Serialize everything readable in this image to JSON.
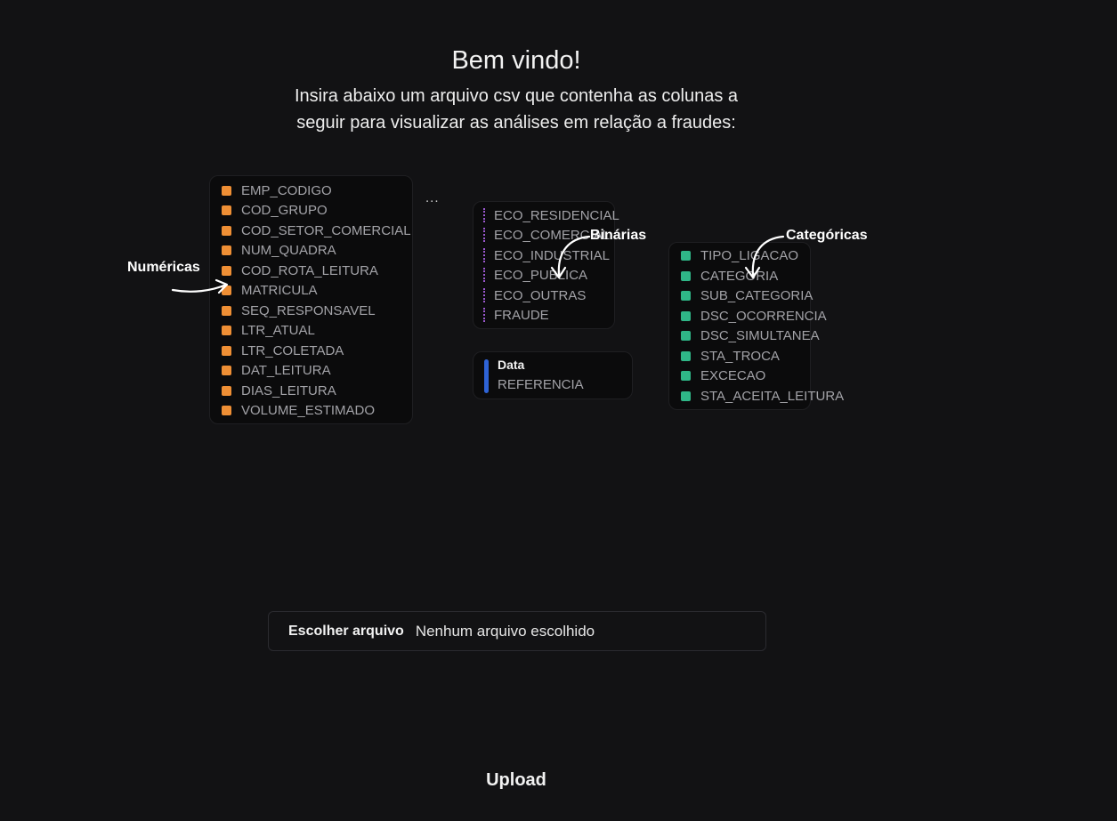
{
  "header": {
    "title": "Bem vindo!",
    "subtitle_line1": "Insira abaixo um arquivo csv que contenha as colunas a",
    "subtitle_line2": "seguir para visualizar as análises em relação a fraudes:"
  },
  "colors": {
    "numeric": "#ef8f35",
    "binary": "#9b59d0",
    "date": "#2e63d6",
    "categorical": "#2fb687",
    "background": "#121214"
  },
  "numeric_columns": {
    "annotation": "Numéricas",
    "items": [
      "EMP_CODIGO",
      "COD_GRUPO",
      "COD_SETOR_COMERCIAL",
      "NUM_QUADRA",
      "COD_ROTA_LEITURA",
      "MATRICULA",
      "SEQ_RESPONSAVEL",
      "LTR_ATUAL",
      "LTR_COLETADA",
      "DAT_LEITURA",
      "DIAS_LEITURA",
      "VOLUME_ESTIMADO"
    ]
  },
  "ellipsis": "...",
  "binary_columns": {
    "annotation": "Binárias",
    "items": [
      "ECO_RESIDENCIAL",
      "ECO_COMERCIAL",
      "ECO_INDUSTRIAL",
      "ECO_PUBLICA",
      "ECO_OUTRAS",
      "FRAUDE"
    ]
  },
  "date_columns": {
    "title": "Data",
    "items": [
      "REFERENCIA"
    ]
  },
  "categorical_columns": {
    "annotation": "Categóricas",
    "items": [
      "TIPO_LIGACAO",
      "CATEGORIA",
      "SUB_CATEGORIA",
      "DSC_OCORRENCIA",
      "DSC_SIMULTANEA",
      "STA_TROCA",
      "EXCECAO",
      "STA_ACEITA_LEITURA"
    ]
  },
  "file_input": {
    "button_label": "Escolher arquivo",
    "status": "Nenhum arquivo escolhido"
  },
  "upload_label": "Upload"
}
